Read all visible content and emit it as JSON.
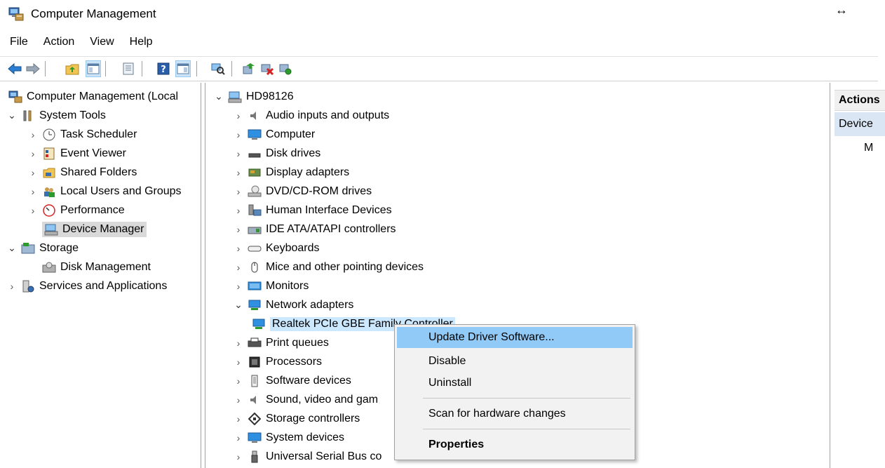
{
  "window": {
    "title": "Computer Management",
    "resize_glyph": "↔"
  },
  "menubar": {
    "items": [
      "File",
      "Action",
      "View",
      "Help"
    ]
  },
  "toolbar": {
    "buttons": [
      "back-arrow-icon",
      "forward-arrow-icon",
      "up-folder-icon",
      "show-hide-console-tree-icon",
      "properties-icon",
      "help-icon",
      "show-hide-action-pane-icon",
      "scan-hardware-icon",
      "update-driver-icon",
      "disable-device-icon",
      "uninstall-device-icon"
    ]
  },
  "left_tree": {
    "root": "Computer Management (Local",
    "system_tools": "System Tools",
    "task_scheduler": "Task Scheduler",
    "event_viewer": "Event Viewer",
    "shared_folders": "Shared Folders",
    "local_users": "Local Users and Groups",
    "performance": "Performance",
    "device_manager": "Device Manager",
    "storage": "Storage",
    "disk_management": "Disk Management",
    "services": "Services and Applications"
  },
  "device_tree": {
    "computer_name": "HD98126",
    "categories": [
      "Audio inputs and outputs",
      "Computer",
      "Disk drives",
      "Display adapters",
      "DVD/CD-ROM drives",
      "Human Interface Devices",
      "IDE ATA/ATAPI controllers",
      "Keyboards",
      "Mice and other pointing devices",
      "Monitors",
      "Network adapters"
    ],
    "network_device": "Realtek PCIe GBE Family Controller",
    "categories_after": [
      "Print queues",
      "Processors",
      "Software devices",
      "Sound, video and gam",
      "Storage controllers",
      "System devices",
      "Universal Serial Bus co"
    ]
  },
  "actions_pane": {
    "header": "Actions",
    "sub": "Device",
    "more": "M"
  },
  "context_menu": {
    "update": "Update Driver Software...",
    "disable": "Disable",
    "uninstall": "Uninstall",
    "scan": "Scan for hardware changes",
    "properties": "Properties"
  }
}
